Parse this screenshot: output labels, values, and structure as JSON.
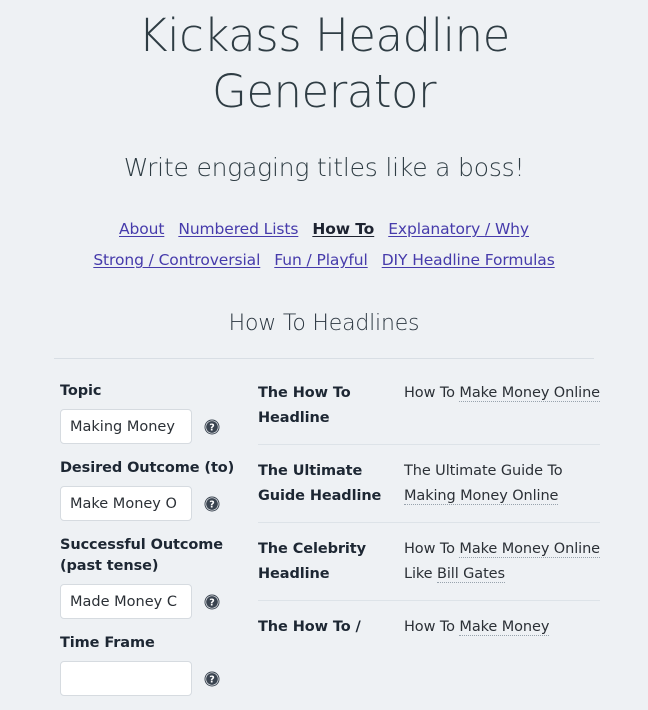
{
  "header": {
    "title": "Kickass Headline Generator",
    "tagline": "Write engaging titles like a boss!"
  },
  "nav": {
    "rows": [
      [
        {
          "label": "About",
          "active": false
        },
        {
          "label": "Numbered Lists",
          "active": false
        },
        {
          "label": "How To",
          "active": true
        },
        {
          "label": "Explanatory / Why",
          "active": false
        }
      ],
      [
        {
          "label": "Strong / Controversial",
          "active": false
        },
        {
          "label": "Fun / Playful",
          "active": false
        },
        {
          "label": "DIY Headline Formulas",
          "active": false
        }
      ]
    ]
  },
  "section": {
    "title": "How To Headlines"
  },
  "form": {
    "fields": [
      {
        "label": "Topic",
        "value": "Making Money",
        "help_icon": "help-circle-icon"
      },
      {
        "label": "Desired Outcome (to)",
        "value": "Make Money O",
        "help_icon": "help-circle-icon"
      },
      {
        "label": "Successful Outcome (past tense)",
        "value": "Made Money C",
        "help_icon": "help-circle-icon"
      },
      {
        "label": "Time Frame",
        "value": "",
        "help_icon": "help-circle-icon"
      }
    ]
  },
  "results": {
    "rows": [
      {
        "name": "The How To Headline",
        "parts": [
          {
            "text": "How To ",
            "variable": false
          },
          {
            "text": "Make Money Online",
            "variable": true
          }
        ]
      },
      {
        "name": "The Ultimate Guide Headline",
        "parts": [
          {
            "text": "The Ultimate Guide To ",
            "variable": false
          },
          {
            "text": "Making Money Online",
            "variable": true
          }
        ]
      },
      {
        "name": "The Celebrity Headline",
        "parts": [
          {
            "text": "How To ",
            "variable": false
          },
          {
            "text": "Make Money Online",
            "variable": true
          },
          {
            "text": " Like ",
            "variable": false
          },
          {
            "text": "Bill Gates",
            "variable": true
          }
        ]
      },
      {
        "name": "The How To /",
        "parts": [
          {
            "text": "How To ",
            "variable": false
          },
          {
            "text": "Make Money",
            "variable": true
          }
        ]
      }
    ]
  },
  "colors": {
    "background": "#eef1f4",
    "link": "#463bab",
    "text_dark": "#1d2733",
    "heading": "#2f3d44",
    "divider": "#d8dee4"
  }
}
